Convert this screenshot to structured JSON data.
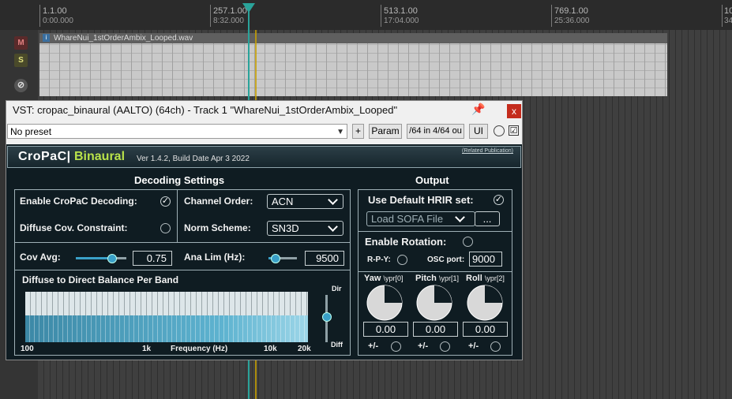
{
  "ruler": {
    "marks": [
      {
        "label": "1.1.00",
        "sub": "0:00.000"
      },
      {
        "label": "257.1.00",
        "sub": "8:32.000"
      },
      {
        "label": "513.1.00",
        "sub": "17:04.000"
      },
      {
        "label": "769.1.00",
        "sub": "25:36.000"
      },
      {
        "label": "10",
        "sub": "34"
      }
    ]
  },
  "track": {
    "mute_label": "M",
    "solo_label": "S",
    "phase_icon": "phase-icon",
    "item_name": "WhareNui_1stOrderAmbix_Looped.wav"
  },
  "vst": {
    "title": "VST: cropac_binaural (AALTO) (64ch) - Track 1 \"WhareNui_1stOrderAmbix_Looped\"",
    "close_label": "x",
    "preset_value": "No preset",
    "plus_label": "+",
    "param_label": "Param",
    "io_label": "/64 in 4/64 ou",
    "ui_label": "UI",
    "bypass_checked": "☑"
  },
  "plugin": {
    "brand_a": "CroPaC|",
    "brand_b": "Binaural",
    "version": "Ver 1.4.2, Build Date Apr  3 2022",
    "publication": "(Related Publication)",
    "decoding": {
      "title": "Decoding Settings",
      "enable_label": "Enable CroPaC Decoding:",
      "enable_checked": "✓",
      "diffuse_label": "Diffuse Cov. Constraint:",
      "channel_order_label": "Channel Order:",
      "channel_order_value": "ACN",
      "norm_label": "Norm Scheme:",
      "norm_value": "SN3D",
      "cov_avg_label": "Cov Avg:",
      "cov_avg_value": "0.75",
      "ana_lim_label": "Ana Lim (Hz):",
      "ana_lim_value": "9500",
      "balance_title": "Diffuse to Direct Balance Per Band",
      "freq_100": "100",
      "freq_1k": "1k",
      "freq_label": "Frequency (Hz)",
      "freq_10k": "10k",
      "freq_20k": "20k",
      "dir_label": "Dir",
      "diff_label": "Diff"
    },
    "output": {
      "title": "Output",
      "hrir_label": "Use Default HRIR set:",
      "hrir_checked": "✓",
      "load_sofa": "Load SOFA File",
      "ellipsis": "...",
      "rotation_label": "Enable Rotation:",
      "rpy_label": "R-P-Y:",
      "osc_label": "OSC port:",
      "osc_value": "9000",
      "yaw_label": "Yaw",
      "yaw_sub": "\\ypr[0]",
      "pitch_label": "Pitch",
      "pitch_sub": "\\ypr[1]",
      "roll_label": "Roll",
      "roll_sub": "\\ypr[2]",
      "yaw_value": "0.00",
      "pitch_value": "0.00",
      "roll_value": "0.00",
      "flip_label": "+/-"
    }
  }
}
